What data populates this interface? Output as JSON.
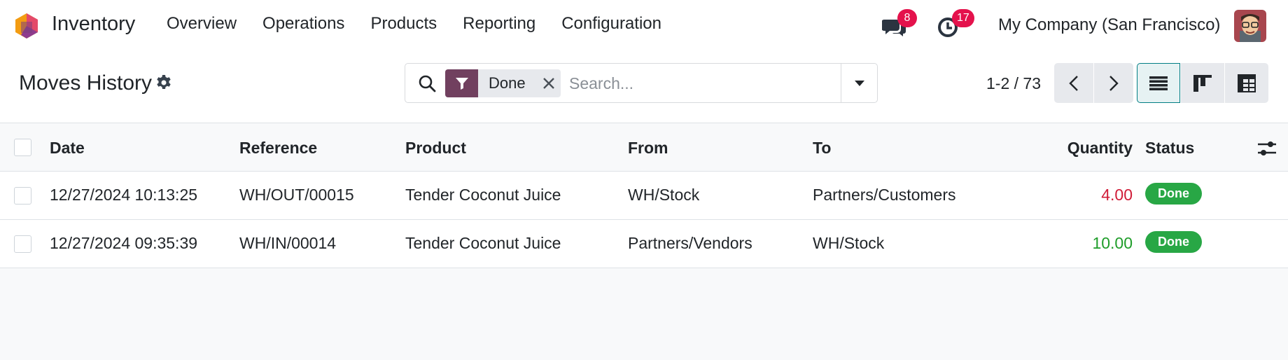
{
  "navbar": {
    "app_name": "Inventory",
    "menu": [
      {
        "label": "Overview"
      },
      {
        "label": "Operations"
      },
      {
        "label": "Products"
      },
      {
        "label": "Reporting"
      },
      {
        "label": "Configuration"
      }
    ],
    "messages_badge": "8",
    "activities_badge": "17",
    "company": "My Company (San Francisco)"
  },
  "control_panel": {
    "title": "Moves History",
    "search": {
      "facet_label": "Done",
      "placeholder": "Search..."
    },
    "pager": "1-2 / 73"
  },
  "list": {
    "columns": {
      "date": "Date",
      "reference": "Reference",
      "product": "Product",
      "from": "From",
      "to": "To",
      "quantity": "Quantity",
      "status": "Status"
    },
    "rows": [
      {
        "date": "12/27/2024 10:13:25",
        "reference": "WH/OUT/00015",
        "product": "Tender Coconut Juice",
        "from": "WH/Stock",
        "to": "Partners/Customers",
        "quantity": "4.00",
        "status": "Done"
      },
      {
        "date": "12/27/2024 09:35:39",
        "reference": "WH/IN/00014",
        "product": "Tender Coconut Juice",
        "from": "Partners/Vendors",
        "to": "WH/Stock",
        "quantity": "10.00",
        "status": "Done"
      }
    ]
  },
  "colors": {
    "brand": "#71405f",
    "accent": "#017e84",
    "badge": "#e4124c",
    "status_done": "#28a745",
    "quantity_out": "#d01c38",
    "quantity_in": "#1f9d2a"
  },
  "icons": {
    "app_logo": "odoo-inventory-logo-icon",
    "messages": "chat-bubbles-icon",
    "activities": "clock-icon",
    "settings": "gear-icon",
    "search": "magnifier-icon",
    "filter": "funnel-icon",
    "facet_remove": "close-icon",
    "search_options": "caret-down-icon",
    "pager_prev": "chevron-left-icon",
    "pager_next": "chevron-right-icon",
    "view_list": "list-view-icon",
    "view_kanban": "kanban-view-icon",
    "view_pivot": "pivot-view-icon",
    "optional_columns": "sliders-icon"
  }
}
